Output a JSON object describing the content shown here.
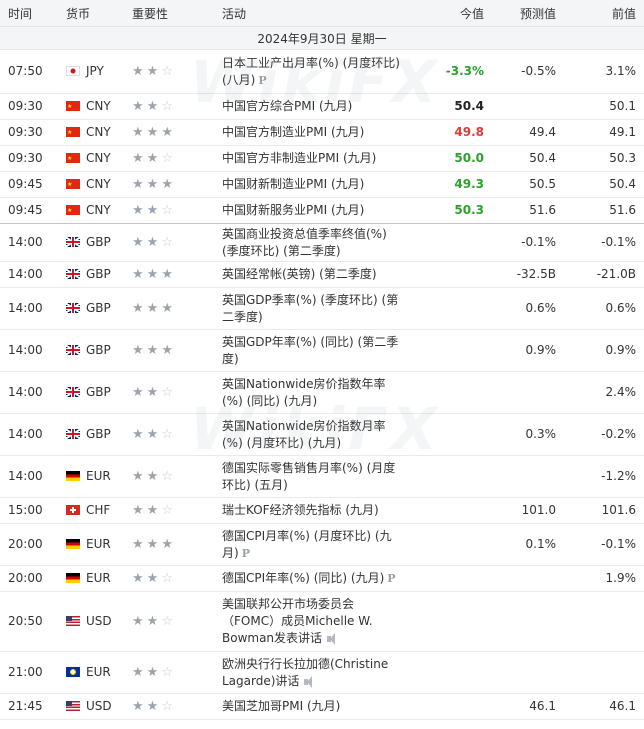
{
  "header": {
    "time": "时间",
    "currency": "货币",
    "importance": "重要性",
    "event": "活动",
    "actual": "今值",
    "forecast": "预测值",
    "previous": "前值"
  },
  "date_label": "2024年9月30日  星期一",
  "watermark": "WikiFX",
  "colors": {
    "up": "#29a329",
    "down": "#e03a3a",
    "star_on": "#9da3ab",
    "star_off": "#c8ccd2"
  },
  "events": [
    {
      "time": "07:50",
      "flag": "jp",
      "currency": "JPY",
      "stars": 2,
      "event": "日本工业产出月率(%) (月度环比) (八月)",
      "p": true,
      "speech": false,
      "actual": "-3.3%",
      "actual_color": "up",
      "forecast": "-0.5%",
      "previous": "3.1%",
      "h": 44
    },
    {
      "time": "09:30",
      "flag": "cn",
      "currency": "CNY",
      "stars": 2,
      "event": "中国官方综合PMI (九月)",
      "p": false,
      "speech": false,
      "actual": "50.4",
      "actual_color": "flat",
      "forecast": "",
      "previous": "50.1",
      "h": 26
    },
    {
      "time": "09:30",
      "flag": "cn",
      "currency": "CNY",
      "stars": 3,
      "event": "中国官方制造业PMI (九月)",
      "p": false,
      "speech": false,
      "actual": "49.8",
      "actual_color": "down",
      "forecast": "49.4",
      "previous": "49.1",
      "h": 26
    },
    {
      "time": "09:30",
      "flag": "cn",
      "currency": "CNY",
      "stars": 2,
      "event": "中国官方非制造业PMI (九月)",
      "p": false,
      "speech": false,
      "actual": "50.0",
      "actual_color": "up",
      "forecast": "50.4",
      "previous": "50.3",
      "h": 26
    },
    {
      "time": "09:45",
      "flag": "cn",
      "currency": "CNY",
      "stars": 3,
      "event": "中国财新制造业PMI (九月)",
      "p": false,
      "speech": false,
      "actual": "49.3",
      "actual_color": "up",
      "forecast": "50.5",
      "previous": "50.4",
      "h": 26
    },
    {
      "time": "09:45",
      "flag": "cn",
      "currency": "CNY",
      "stars": 2,
      "event": "中国财新服务业PMI (九月)",
      "p": false,
      "speech": false,
      "actual": "50.3",
      "actual_color": "up",
      "forecast": "51.6",
      "previous": "51.6",
      "h": 26,
      "sep": true
    },
    {
      "time": "14:00",
      "flag": "gb",
      "currency": "GBP",
      "stars": 2,
      "event": "英国商业投资总值季率终值(%) (季度环比) (第二季度)",
      "p": false,
      "speech": false,
      "actual": "",
      "actual_color": "flat",
      "forecast": "-0.1%",
      "previous": "-0.1%",
      "h": 38
    },
    {
      "time": "14:00",
      "flag": "gb",
      "currency": "GBP",
      "stars": 3,
      "event": "英国经常帐(英镑) (第二季度)",
      "p": false,
      "speech": false,
      "actual": "",
      "actual_color": "flat",
      "forecast": "-32.5B",
      "previous": "-21.0B",
      "h": 26
    },
    {
      "time": "14:00",
      "flag": "gb",
      "currency": "GBP",
      "stars": 3,
      "event": "英国GDP季率(%) (季度环比) (第二季度)",
      "p": false,
      "speech": false,
      "actual": "",
      "actual_color": "flat",
      "forecast": "0.6%",
      "previous": "0.6%",
      "h": 42
    },
    {
      "time": "14:00",
      "flag": "gb",
      "currency": "GBP",
      "stars": 3,
      "event": "英国GDP年率(%) (同比) (第二季度)",
      "p": false,
      "speech": false,
      "actual": "",
      "actual_color": "flat",
      "forecast": "0.9%",
      "previous": "0.9%",
      "h": 42
    },
    {
      "time": "14:00",
      "flag": "gb",
      "currency": "GBP",
      "stars": 2,
      "event": "英国Nationwide房价指数年率(%) (同比) (九月)",
      "p": false,
      "speech": false,
      "actual": "",
      "actual_color": "flat",
      "forecast": "",
      "previous": "2.4%",
      "h": 42
    },
    {
      "time": "14:00",
      "flag": "gb",
      "currency": "GBP",
      "stars": 2,
      "event": "英国Nationwide房价指数月率(%) (月度环比) (九月)",
      "p": false,
      "speech": false,
      "actual": "",
      "actual_color": "flat",
      "forecast": "0.3%",
      "previous": "-0.2%",
      "h": 42
    },
    {
      "time": "14:00",
      "flag": "de",
      "currency": "EUR",
      "stars": 2,
      "event": "德国实际零售销售月率(%) (月度环比) (五月)",
      "p": false,
      "speech": false,
      "actual": "",
      "actual_color": "flat",
      "forecast": "",
      "previous": "-1.2%",
      "h": 42
    },
    {
      "time": "15:00",
      "flag": "ch",
      "currency": "CHF",
      "stars": 2,
      "event": "瑞士KOF经济领先指标 (九月)",
      "p": false,
      "speech": false,
      "actual": "",
      "actual_color": "flat",
      "forecast": "101.0",
      "previous": "101.6",
      "h": 26
    },
    {
      "time": "20:00",
      "flag": "de",
      "currency": "EUR",
      "stars": 3,
      "event": "德国CPI月率(%) (月度环比) (九月)",
      "p": true,
      "speech": false,
      "actual": "",
      "actual_color": "flat",
      "forecast": "0.1%",
      "previous": "-0.1%",
      "h": 42
    },
    {
      "time": "20:00",
      "flag": "de",
      "currency": "EUR",
      "stars": 2,
      "event": "德国CPI年率(%) (同比) (九月)",
      "p": true,
      "speech": false,
      "actual": "",
      "actual_color": "flat",
      "forecast": "",
      "previous": "1.9%",
      "h": 26
    },
    {
      "time": "20:50",
      "flag": "us",
      "currency": "USD",
      "stars": 2,
      "event": "美国联邦公开市场委员会（FOMC）成员Michelle W. Bowman发表讲话",
      "p": false,
      "speech": true,
      "actual": "",
      "actual_color": "flat",
      "forecast": "",
      "previous": "",
      "h": 60
    },
    {
      "time": "21:00",
      "flag": "eu",
      "currency": "EUR",
      "stars": 2,
      "event": "欧洲央行行长拉加德(Christine Lagarde)讲话",
      "p": false,
      "speech": true,
      "actual": "",
      "actual_color": "flat",
      "forecast": "",
      "previous": "",
      "h": 42
    },
    {
      "time": "21:45",
      "flag": "us",
      "currency": "USD",
      "stars": 2,
      "event": "美国芝加哥PMI (九月)",
      "p": false,
      "speech": false,
      "actual": "",
      "actual_color": "flat",
      "forecast": "46.1",
      "previous": "46.1",
      "h": 26
    }
  ]
}
